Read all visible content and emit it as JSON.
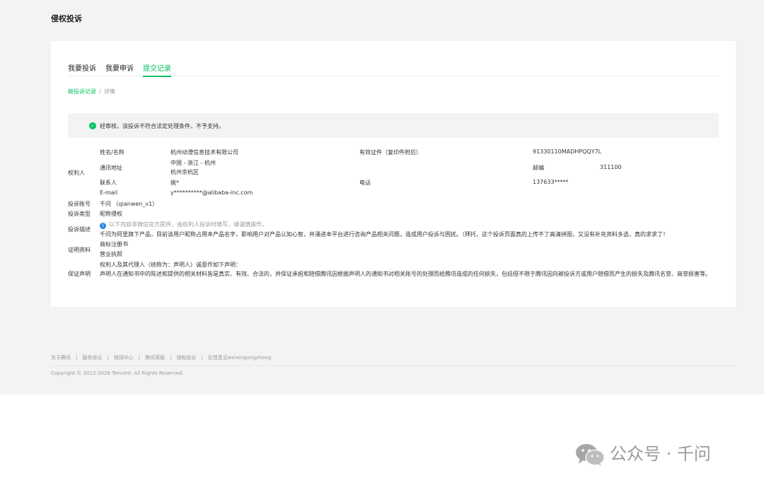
{
  "page": {
    "title": "侵权投诉"
  },
  "tabs": [
    "我要投诉",
    "我要申诉",
    "提交记录"
  ],
  "breadcrumb": {
    "parent": "被投诉记录",
    "separator": "/",
    "current": "详情"
  },
  "notice": "经审核，该投诉不符合法定处理条件，不予支持。",
  "rightsholder": {
    "group_label": "权利人",
    "name_label": "姓名/名称",
    "name_value": "杭州动澄信息技术有限公司",
    "cert_label": "有效证件（复印件附后）",
    "cert_value": "91330110MADHPQQY7L",
    "address_label": "通讯地址",
    "address_line1": "中国 - 浙江 - 杭州",
    "address_line2": "杭州余杭区",
    "postcode_label": "邮编",
    "postcode_value": "311100",
    "contact_label": "联系人",
    "contact_value": "姚*",
    "phone_label": "电话",
    "phone_value": "137633*****",
    "email_label": "E-mail",
    "email_value": "y**********@alibaba-inc.com"
  },
  "account": {
    "label": "投诉账号",
    "value": "千问 （qianwen_v1）"
  },
  "type": {
    "label": "投诉类型",
    "value": "昵称侵权"
  },
  "description": {
    "label": "投诉描述",
    "hint": "以下内容非微信官方提供，由权利人投诉时填写，请谨慎操作。",
    "text": "千问为阿里旗下产品，目前该用户昵称占用本产品名字，影响用户对产品认知心智，并涌进本平台进行咨询产品相关问题，造成用户投诉与困扰。（拜托，这个投诉页面真的上传不了高清拼图，又没有补充资料多选，真的求求了！"
  },
  "evidence": {
    "label": "证明资料",
    "items": [
      "商标注册书",
      "营业执照"
    ]
  },
  "declaration": {
    "label": "保证声明",
    "line1": "权利人及其代理人（统称为：声明人）诚意作如下声明：",
    "line2": "声明人在通知书中的陈述和提供的相关材料皆是真实、有效、合法的，并保证承担和赔偿腾讯因根据声明人的通知书对相关账号的处理而给腾讯造成的任何损失，包括但不限于腾讯因向被投诉方或用户赔偿而产生的损失及腾讯名誉、商誉损害等。"
  },
  "footer": {
    "links": [
      "关于腾讯",
      "服务协议",
      "规则中心",
      "腾讯客服",
      "侵权投诉",
      "反馈意见weixingongzhong"
    ],
    "separator": "|",
    "copyright": "Copyright © 2012-2026 Tencent. All Rights Reserved."
  },
  "watermark": {
    "text": "公众号 · 千问",
    "icon": "wechat-icon"
  },
  "colors": {
    "accent": "#07c160",
    "info": "#2a86e3",
    "background": "#f3f3f4"
  }
}
